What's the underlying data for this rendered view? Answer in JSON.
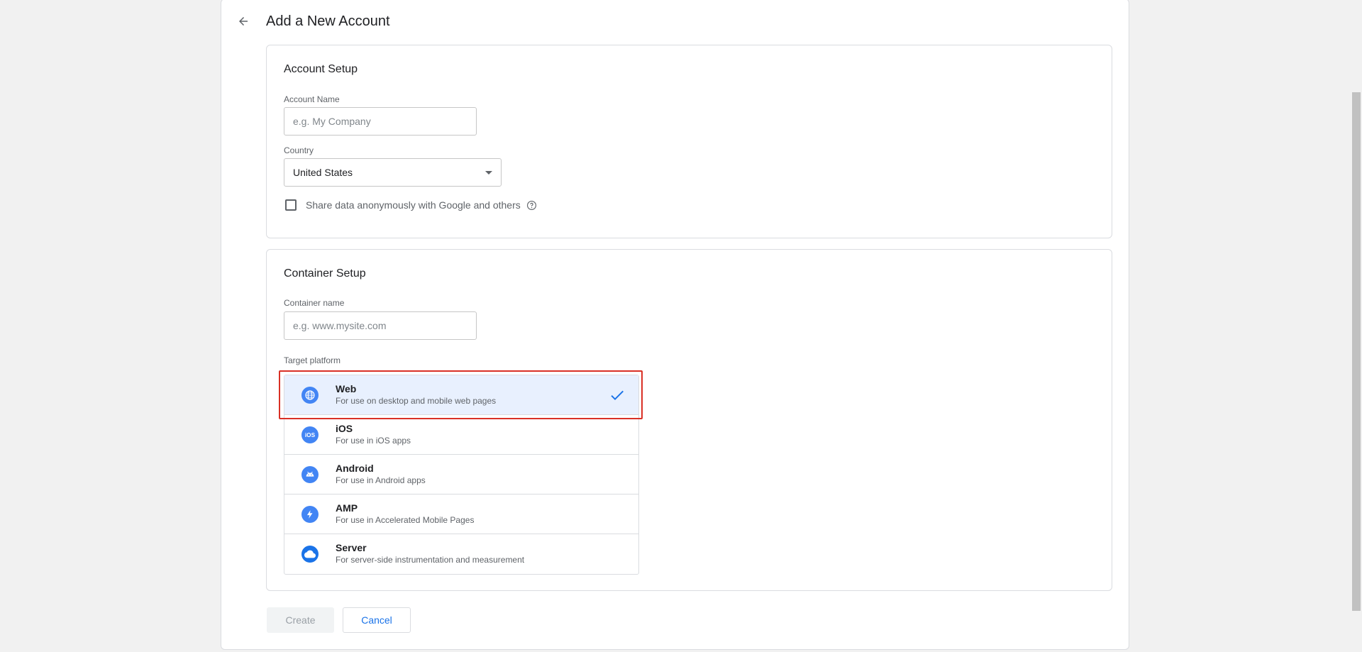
{
  "header": {
    "title": "Add a New Account"
  },
  "account_setup": {
    "title": "Account Setup",
    "account_name_label": "Account Name",
    "account_name_placeholder": "e.g. My Company",
    "account_name_value": "",
    "country_label": "Country",
    "country_value": "United States",
    "share_data_label": "Share data anonymously with Google and others",
    "share_data_checked": false
  },
  "container_setup": {
    "title": "Container Setup",
    "container_name_label": "Container name",
    "container_name_placeholder": "e.g. www.mysite.com",
    "container_name_value": "",
    "target_platform_label": "Target platform",
    "platforms": [
      {
        "name": "Web",
        "description": "For use on desktop and mobile web pages",
        "icon": "globe-icon",
        "selected": true
      },
      {
        "name": "iOS",
        "description": "For use in iOS apps",
        "icon": "ios-icon",
        "selected": false
      },
      {
        "name": "Android",
        "description": "For use in Android apps",
        "icon": "android-icon",
        "selected": false
      },
      {
        "name": "AMP",
        "description": "For use in Accelerated Mobile Pages",
        "icon": "amp-bolt-icon",
        "selected": false
      },
      {
        "name": "Server",
        "description": "For server-side instrumentation and measurement",
        "icon": "cloud-icon",
        "selected": false
      }
    ]
  },
  "actions": {
    "create_label": "Create",
    "cancel_label": "Cancel"
  },
  "colors": {
    "accent": "#1a73e8",
    "platform_icon": "#4285f4",
    "selected_bg": "#e8f0fe",
    "highlight_border": "#d93025"
  }
}
